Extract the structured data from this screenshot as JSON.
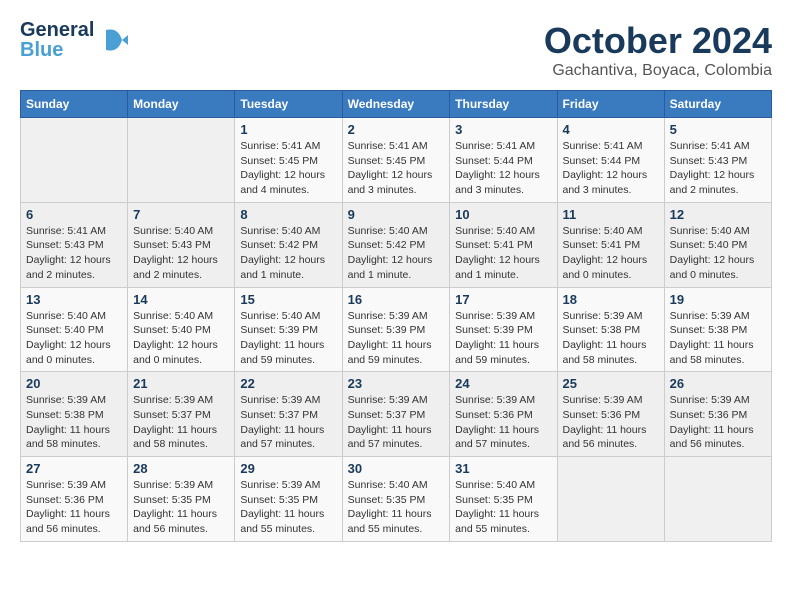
{
  "logo": {
    "line1": "General",
    "line2": "Blue",
    "arrow": "▶"
  },
  "title": "October 2024",
  "subtitle": "Gachantiva, Boyaca, Colombia",
  "days_of_week": [
    "Sunday",
    "Monday",
    "Tuesday",
    "Wednesday",
    "Thursday",
    "Friday",
    "Saturday"
  ],
  "weeks": [
    [
      {
        "day": "",
        "info": ""
      },
      {
        "day": "",
        "info": ""
      },
      {
        "day": "1",
        "info": "Sunrise: 5:41 AM\nSunset: 5:45 PM\nDaylight: 12 hours\nand 4 minutes."
      },
      {
        "day": "2",
        "info": "Sunrise: 5:41 AM\nSunset: 5:45 PM\nDaylight: 12 hours\nand 3 minutes."
      },
      {
        "day": "3",
        "info": "Sunrise: 5:41 AM\nSunset: 5:44 PM\nDaylight: 12 hours\nand 3 minutes."
      },
      {
        "day": "4",
        "info": "Sunrise: 5:41 AM\nSunset: 5:44 PM\nDaylight: 12 hours\nand 3 minutes."
      },
      {
        "day": "5",
        "info": "Sunrise: 5:41 AM\nSunset: 5:43 PM\nDaylight: 12 hours\nand 2 minutes."
      }
    ],
    [
      {
        "day": "6",
        "info": "Sunrise: 5:41 AM\nSunset: 5:43 PM\nDaylight: 12 hours\nand 2 minutes."
      },
      {
        "day": "7",
        "info": "Sunrise: 5:40 AM\nSunset: 5:43 PM\nDaylight: 12 hours\nand 2 minutes."
      },
      {
        "day": "8",
        "info": "Sunrise: 5:40 AM\nSunset: 5:42 PM\nDaylight: 12 hours\nand 1 minute."
      },
      {
        "day": "9",
        "info": "Sunrise: 5:40 AM\nSunset: 5:42 PM\nDaylight: 12 hours\nand 1 minute."
      },
      {
        "day": "10",
        "info": "Sunrise: 5:40 AM\nSunset: 5:41 PM\nDaylight: 12 hours\nand 1 minute."
      },
      {
        "day": "11",
        "info": "Sunrise: 5:40 AM\nSunset: 5:41 PM\nDaylight: 12 hours\nand 0 minutes."
      },
      {
        "day": "12",
        "info": "Sunrise: 5:40 AM\nSunset: 5:40 PM\nDaylight: 12 hours\nand 0 minutes."
      }
    ],
    [
      {
        "day": "13",
        "info": "Sunrise: 5:40 AM\nSunset: 5:40 PM\nDaylight: 12 hours\nand 0 minutes."
      },
      {
        "day": "14",
        "info": "Sunrise: 5:40 AM\nSunset: 5:40 PM\nDaylight: 12 hours\nand 0 minutes."
      },
      {
        "day": "15",
        "info": "Sunrise: 5:40 AM\nSunset: 5:39 PM\nDaylight: 11 hours\nand 59 minutes."
      },
      {
        "day": "16",
        "info": "Sunrise: 5:39 AM\nSunset: 5:39 PM\nDaylight: 11 hours\nand 59 minutes."
      },
      {
        "day": "17",
        "info": "Sunrise: 5:39 AM\nSunset: 5:39 PM\nDaylight: 11 hours\nand 59 minutes."
      },
      {
        "day": "18",
        "info": "Sunrise: 5:39 AM\nSunset: 5:38 PM\nDaylight: 11 hours\nand 58 minutes."
      },
      {
        "day": "19",
        "info": "Sunrise: 5:39 AM\nSunset: 5:38 PM\nDaylight: 11 hours\nand 58 minutes."
      }
    ],
    [
      {
        "day": "20",
        "info": "Sunrise: 5:39 AM\nSunset: 5:38 PM\nDaylight: 11 hours\nand 58 minutes."
      },
      {
        "day": "21",
        "info": "Sunrise: 5:39 AM\nSunset: 5:37 PM\nDaylight: 11 hours\nand 58 minutes."
      },
      {
        "day": "22",
        "info": "Sunrise: 5:39 AM\nSunset: 5:37 PM\nDaylight: 11 hours\nand 57 minutes."
      },
      {
        "day": "23",
        "info": "Sunrise: 5:39 AM\nSunset: 5:37 PM\nDaylight: 11 hours\nand 57 minutes."
      },
      {
        "day": "24",
        "info": "Sunrise: 5:39 AM\nSunset: 5:36 PM\nDaylight: 11 hours\nand 57 minutes."
      },
      {
        "day": "25",
        "info": "Sunrise: 5:39 AM\nSunset: 5:36 PM\nDaylight: 11 hours\nand 56 minutes."
      },
      {
        "day": "26",
        "info": "Sunrise: 5:39 AM\nSunset: 5:36 PM\nDaylight: 11 hours\nand 56 minutes."
      }
    ],
    [
      {
        "day": "27",
        "info": "Sunrise: 5:39 AM\nSunset: 5:36 PM\nDaylight: 11 hours\nand 56 minutes."
      },
      {
        "day": "28",
        "info": "Sunrise: 5:39 AM\nSunset: 5:35 PM\nDaylight: 11 hours\nand 56 minutes."
      },
      {
        "day": "29",
        "info": "Sunrise: 5:39 AM\nSunset: 5:35 PM\nDaylight: 11 hours\nand 55 minutes."
      },
      {
        "day": "30",
        "info": "Sunrise: 5:40 AM\nSunset: 5:35 PM\nDaylight: 11 hours\nand 55 minutes."
      },
      {
        "day": "31",
        "info": "Sunrise: 5:40 AM\nSunset: 5:35 PM\nDaylight: 11 hours\nand 55 minutes."
      },
      {
        "day": "",
        "info": ""
      },
      {
        "day": "",
        "info": ""
      }
    ]
  ]
}
